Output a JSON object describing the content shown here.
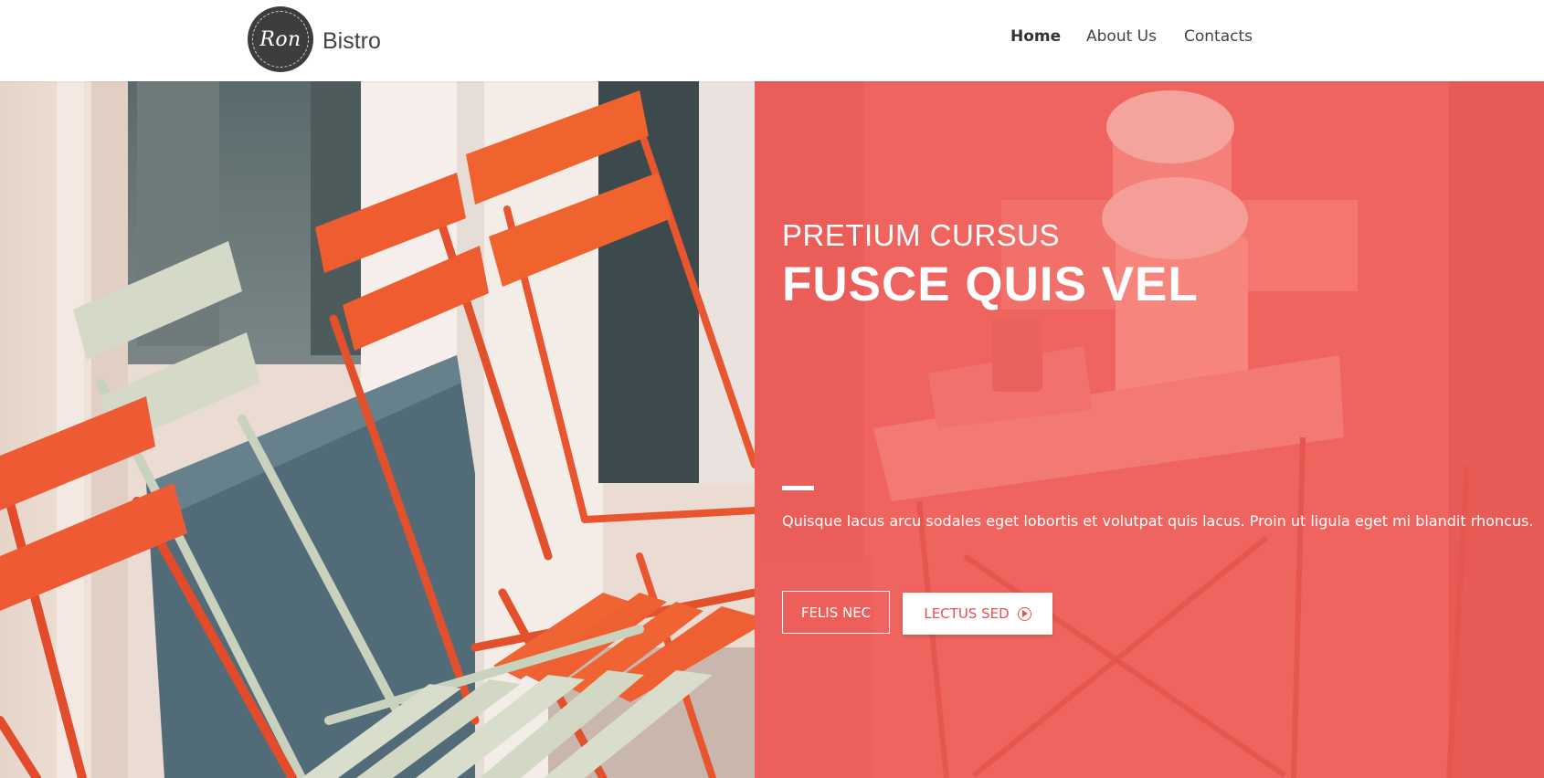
{
  "header": {
    "logo_text": "Ron",
    "brand_name": "Bistro",
    "nav": [
      {
        "label": "Home",
        "active": true
      },
      {
        "label": "About Us",
        "active": false
      },
      {
        "label": "Contacts",
        "active": false
      }
    ]
  },
  "hero": {
    "subtitle": "PRETIUM CURSUS",
    "title": "FUSCE QUIS VEL",
    "description": "Quisque lacus arcu sodales eget lobortis et volutpat quis lacus. Proin ut ligula eget mi blandit rhoncus.",
    "primary_button": "FELIS NEC",
    "secondary_button": "LECTUS SED",
    "overlay_color": "#ef645f",
    "accent_color": "#e8524d"
  }
}
